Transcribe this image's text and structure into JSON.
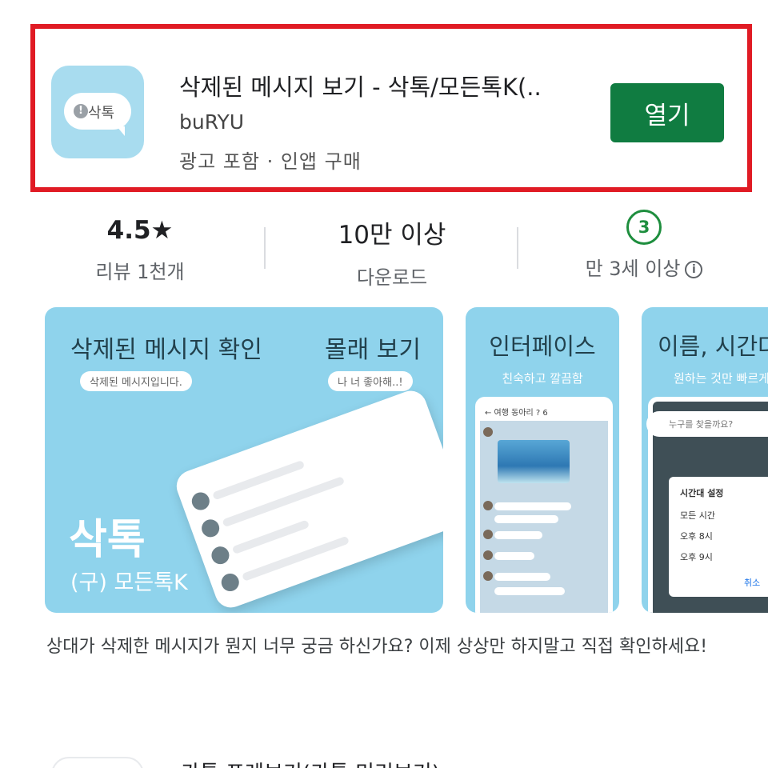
{
  "app": {
    "icon_label": "삭톡",
    "icon_mark": "!",
    "title": "삭제된 메시지 보기 - 삭톡/모든톡K(..",
    "developer": "buRYU",
    "meta": "광고 포함 · 인앱 구매",
    "open_label": "열기",
    "open_color": "#107c41"
  },
  "stats": {
    "rating": "4.5★",
    "rating_label": "리뷰 1천개",
    "downloads": "10만 이상",
    "downloads_label": "다운로드",
    "age_badge": "3",
    "age_label": "만 3세 이상",
    "info_icon": "ⓘ"
  },
  "screenshots": {
    "s1": {
      "heading_left": "삭제된 메시지 확인",
      "heading_right": "몰래 보기",
      "pill_left": "삭제된 메시지입니다.",
      "pill_right": "나 너 좋아해..!",
      "title": "삭톡",
      "subtitle": "(구) 모든톡K"
    },
    "s2": {
      "heading": "인터페이스",
      "subheading": "친숙하고 깔끔함",
      "chat_title": "← 여행 동아리 ? 6"
    },
    "s3": {
      "heading": "이름, 시간다",
      "subheading": "원하는 것만 빠르게",
      "search_placeholder": "누구를 찾을까요?",
      "dialog_title": "시간대 설정",
      "option1": "모든 시간",
      "option2": "오후 8시",
      "option3": "오후 9시",
      "cancel": "취소"
    }
  },
  "description": "상대가 삭제한 메시지가 뭔지 너무 궁금 하신가요? 이제 상상만 하지말고 직접 확인하세요!",
  "next_item": {
    "title": "카톡 프레브기(카톡 미리보기)"
  }
}
